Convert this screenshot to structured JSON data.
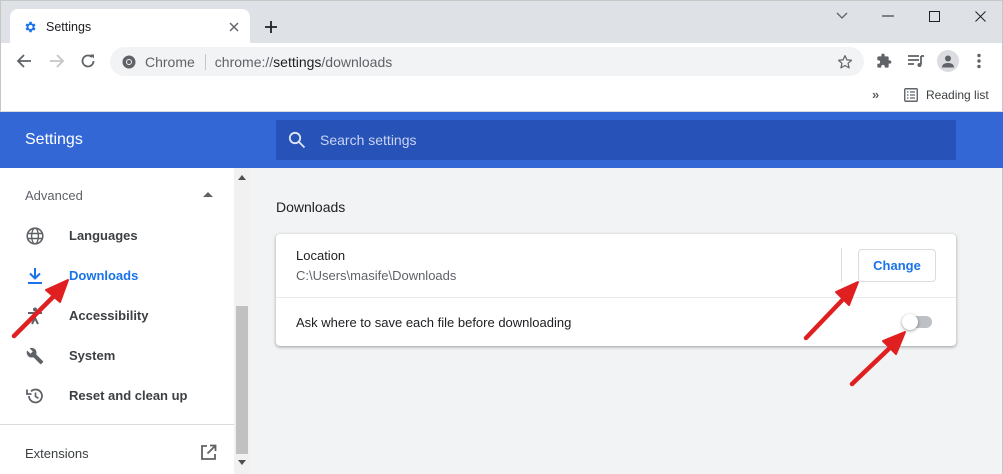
{
  "browser": {
    "tab_title": "Settings",
    "omnibox": {
      "secure_label": "Chrome",
      "url_prefix": "chrome://",
      "url_host": "settings",
      "url_path": "/downloads"
    },
    "bookmarks": {
      "reading_list_label": "Reading list"
    }
  },
  "settings": {
    "header_title": "Settings",
    "search_placeholder": "Search settings",
    "sidebar": {
      "section_label": "Advanced",
      "items": [
        {
          "label": "Languages",
          "icon": "globe-icon"
        },
        {
          "label": "Downloads",
          "icon": "download-icon",
          "active": true
        },
        {
          "label": "Accessibility",
          "icon": "accessibility-icon"
        },
        {
          "label": "System",
          "icon": "wrench-icon"
        },
        {
          "label": "Reset and clean up",
          "icon": "history-icon"
        }
      ],
      "extensions_label": "Extensions"
    },
    "main": {
      "heading": "Downloads",
      "location_label": "Location",
      "location_path": "C:\\Users\\masife\\Downloads",
      "change_button": "Change",
      "ask_label": "Ask where to save each file before downloading",
      "ask_enabled": false
    }
  },
  "colors": {
    "header_blue": "#3367d6",
    "search_blue": "#2752b8",
    "accent_blue": "#1a73e8",
    "annotation_red": "#e02020"
  }
}
